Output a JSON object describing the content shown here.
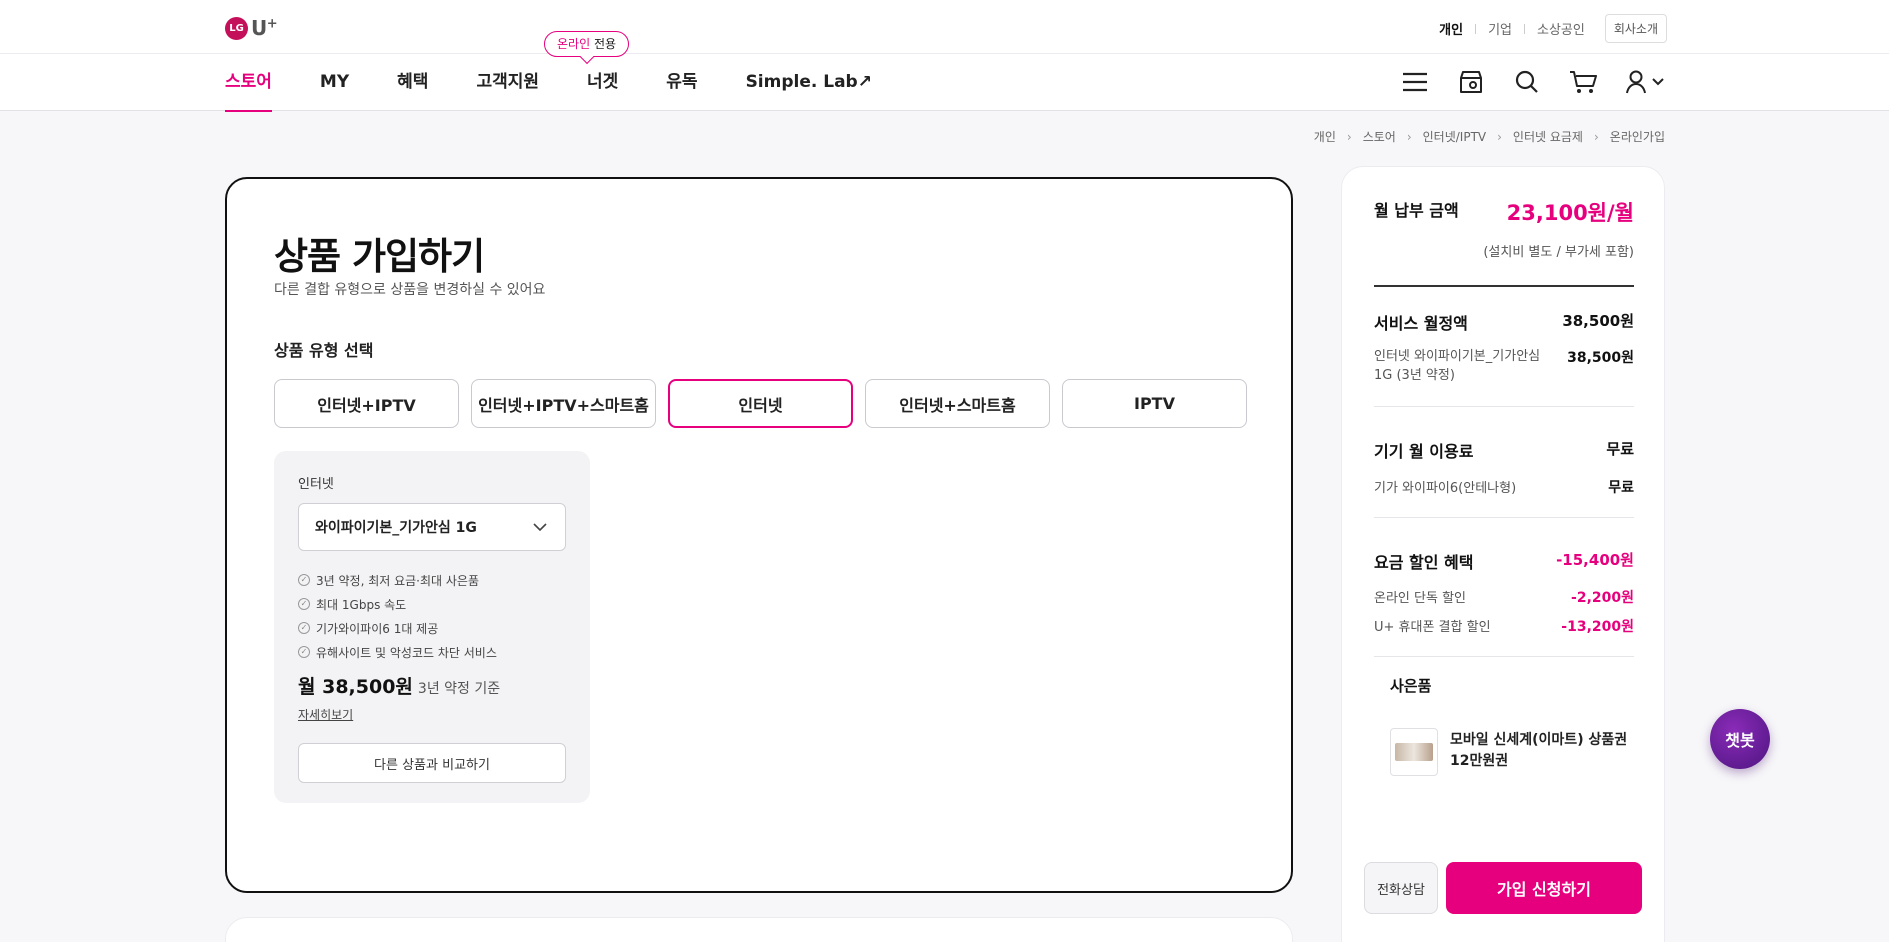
{
  "header": {
    "logo_mark": "LG",
    "logo_text": "U",
    "logo_sup": "+",
    "util_links": [
      "개인",
      "기업",
      "소상공인"
    ],
    "company_button": "회사소개"
  },
  "nav": {
    "items": [
      "스토어",
      "MY",
      "혜택",
      "고객지원",
      "너겟",
      "유독",
      "Simple. Lab↗"
    ],
    "online_tag_pink": "온라인",
    "online_tag_rest": " 전용",
    "icons": [
      "menu-icon",
      "store-location-icon",
      "search-icon",
      "cart-icon",
      "user-icon"
    ]
  },
  "breadcrumb": [
    "개인",
    "스토어",
    "인터넷/IPTV",
    "인터넷 요금제",
    "온라인가입"
  ],
  "main": {
    "title": "상품 가입하기",
    "subtitle": "다른 결합 유형으로 상품을 변경하실 수 있어요",
    "section_title": "상품 유형 선택",
    "types": [
      "인터넷+IPTV",
      "인터넷+IPTV+스마트홈",
      "인터넷",
      "인터넷+스마트홈",
      "IPTV"
    ],
    "selected_type": "인터넷",
    "product": {
      "label": "인터넷",
      "selected_plan": "와이파이기본_기가안심 1G",
      "features": [
        "3년 약정, 최저 요금·최대 사은품",
        "최대 1Gbps 속도",
        "기가와이파이6 1대 제공",
        "유해사이트 및 악성코드 차단 서비스"
      ],
      "price": "월 38,500원",
      "price_term": "3년 약정 기준",
      "detail_link": "자세히보기",
      "compare_button": "다른 상품과 비교하기"
    }
  },
  "summary": {
    "monthly_label": "월 납부 금액",
    "monthly_price": "23,100원/월",
    "monthly_note": "(설치비 별도 / 부가세 포함)",
    "service_label": "서비스 월정액",
    "service_value": "38,500원",
    "service_item": "인터넷 와이파이기본_기가안심 1G (3년 약정)",
    "service_item_value": "38,500원",
    "device_label": "기기 월 이용료",
    "device_value": "무료",
    "device_item": "기가 와이파이6(안테나형)",
    "device_item_value": "무료",
    "discount_label": "요금 할인 혜택",
    "discount_value": "-15,400원",
    "discount_items": [
      {
        "label": "온라인 단독 할인",
        "value": "-2,200원"
      },
      {
        "label": "U+ 휴대폰 결합 할인",
        "value": "-13,200원"
      }
    ],
    "gift_title": "사은품",
    "gift_name": "모바일 신세계(이마트) 상품권 12만원권",
    "call_button": "전화상담",
    "join_button": "가입 신청하기"
  },
  "chatbot": "챗봇",
  "colors": {
    "accent": "#e6007e",
    "chatbot": "#5b1a8f"
  }
}
